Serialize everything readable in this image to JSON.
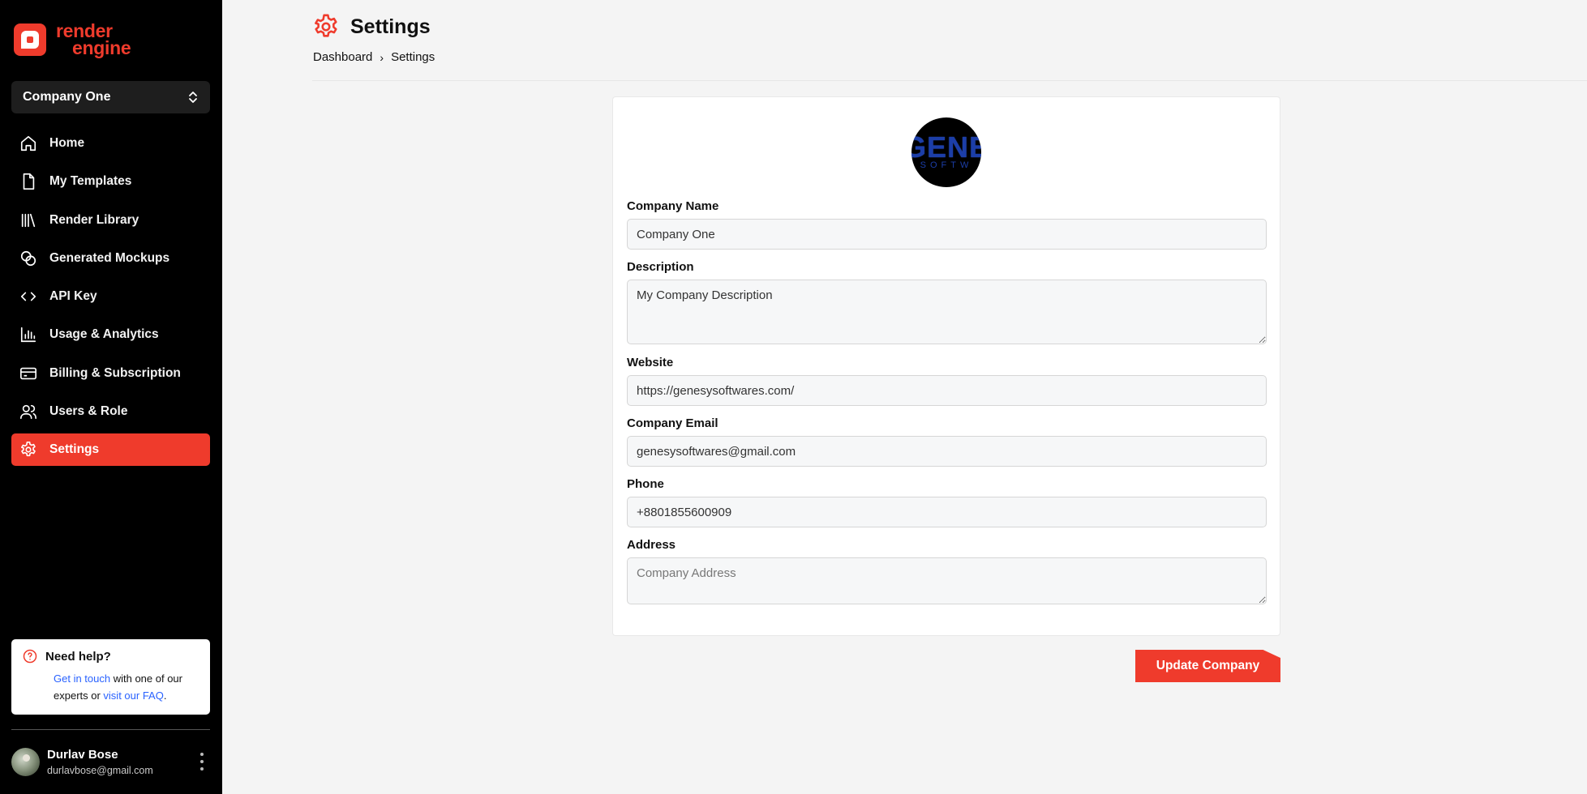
{
  "brand": {
    "line1": "render",
    "line2": "engine",
    "accent": "#ef3b2c"
  },
  "company_selector": {
    "value": "Company One"
  },
  "nav": {
    "items": [
      {
        "label": "Home",
        "icon": "home-icon"
      },
      {
        "label": "My Templates",
        "icon": "file-icon"
      },
      {
        "label": "Render Library",
        "icon": "library-icon"
      },
      {
        "label": "Generated Mockups",
        "icon": "mockups-icon"
      },
      {
        "label": "API Key",
        "icon": "code-icon"
      },
      {
        "label": "Usage & Analytics",
        "icon": "chart-icon"
      },
      {
        "label": "Billing & Subscription",
        "icon": "card-icon"
      },
      {
        "label": "Users & Role",
        "icon": "users-icon"
      },
      {
        "label": "Settings",
        "icon": "gear-icon",
        "active": true
      }
    ]
  },
  "help": {
    "title": "Need help?",
    "link1": "Get in touch",
    "text1": " with one of our experts or ",
    "link2": "visit our FAQ",
    "text2": "."
  },
  "user": {
    "name": "Durlav Bose",
    "email": "durlavbose@gmail.com"
  },
  "page": {
    "title": "Settings",
    "breadcrumb": {
      "parent": "Dashboard",
      "separator": "›",
      "current": "Settings"
    }
  },
  "company_logo": {
    "line1": "GENE",
    "line2": "SOFTW"
  },
  "form": {
    "company_name": {
      "label": "Company Name",
      "value": "Company One"
    },
    "description": {
      "label": "Description",
      "value": "My Company Description"
    },
    "website": {
      "label": "Website",
      "value": "https://genesysoftwares.com/"
    },
    "email": {
      "label": "Company Email",
      "value": "genesysoftwares@gmail.com"
    },
    "phone": {
      "label": "Phone",
      "value": "+8801855600909"
    },
    "address": {
      "label": "Address",
      "placeholder": "Company Address",
      "value": ""
    }
  },
  "actions": {
    "update_label": "Update Company"
  }
}
